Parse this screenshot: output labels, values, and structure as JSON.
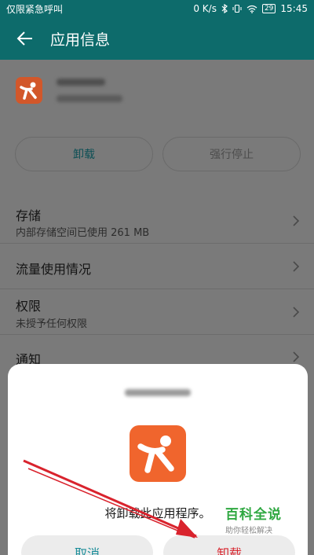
{
  "status_bar": {
    "carrier_text": "仅限紧急呼叫",
    "speed": "0 K/s",
    "battery": "29",
    "time": "15:45"
  },
  "header": {
    "title": "应用信息"
  },
  "buttons": {
    "uninstall": "卸载",
    "force_stop": "强行停止"
  },
  "settings": [
    {
      "label": "存储",
      "sub": "内部存储空间已使用 261 MB"
    },
    {
      "label": "流量使用情况",
      "sub": ""
    },
    {
      "label": "权限",
      "sub": "未授予任何权限"
    },
    {
      "label": "通知",
      "sub": ""
    }
  ],
  "dialog": {
    "message": "将卸载此应用程序。",
    "cancel": "取消",
    "confirm": "卸载"
  },
  "watermark": {
    "title": "百科全说",
    "subtitle": "助你轻松解决"
  },
  "colors": {
    "toolbar": "#0d6b6b",
    "app_icon": "#f0652d",
    "confirm_text": "#d8262f",
    "cancel_text": "#1b8d99",
    "annotation_arrow": "#d9232d"
  }
}
